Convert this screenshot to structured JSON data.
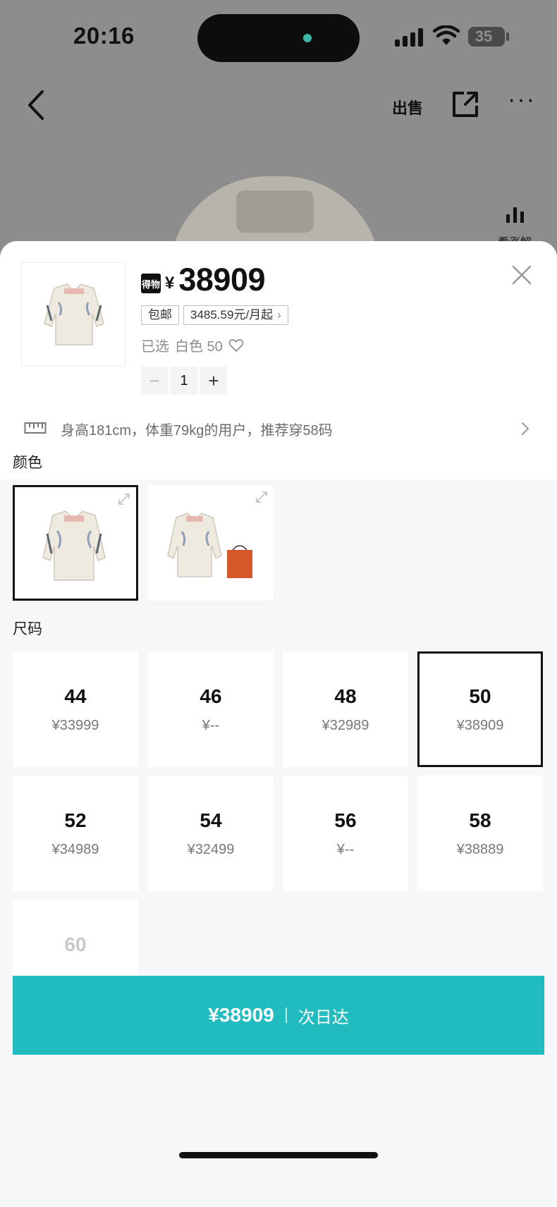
{
  "status_bar": {
    "time": "20:16",
    "battery": "35"
  },
  "nav": {
    "back_icon": "chevron-left-icon",
    "sell_label": "出售",
    "share_icon": "share-icon",
    "more_label": "···"
  },
  "background": {
    "chart_label": "看涨解"
  },
  "sheet": {
    "price_badge": "得物",
    "currency": "¥",
    "price": "38909",
    "tags": [
      {
        "label": "包邮"
      },
      {
        "label": "3485.59元/月起",
        "chevron": "›"
      }
    ],
    "selected_prefix": "已选",
    "selected_value": "白色 50",
    "quantity": {
      "minus": "−",
      "value": "1",
      "plus": "+"
    },
    "recommendation": "身高181cm，体重79kg的用户，推荐穿58码",
    "color_section_label": "颜色",
    "colors": [
      {
        "name": "white-jacket",
        "selected": true
      },
      {
        "name": "white-jacket-with-bag",
        "selected": false
      }
    ],
    "size_section_label": "尺码",
    "sizes": [
      {
        "size": "44",
        "price": "¥33999",
        "selected": false
      },
      {
        "size": "46",
        "price": "¥--",
        "selected": false
      },
      {
        "size": "48",
        "price": "¥32989",
        "selected": false
      },
      {
        "size": "50",
        "price": "¥38909",
        "selected": true
      },
      {
        "size": "52",
        "price": "¥34989",
        "selected": false
      },
      {
        "size": "54",
        "price": "¥32499",
        "selected": false
      },
      {
        "size": "56",
        "price": "¥--",
        "selected": false
      },
      {
        "size": "58",
        "price": "¥38889",
        "selected": false
      },
      {
        "size": "60",
        "price": "",
        "selected": false,
        "disabled": true
      }
    ],
    "buy_button": {
      "price": "¥38909",
      "label": "次日达"
    }
  },
  "colors": {
    "accent": "#21BCC0",
    "selected_border": "#111111",
    "sheet_background": "#F7F7FA"
  }
}
